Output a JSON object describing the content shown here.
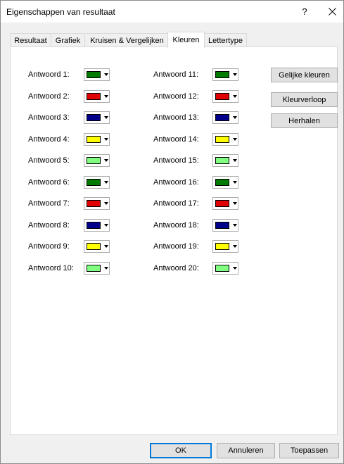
{
  "window": {
    "title": "Eigenschappen van resultaat",
    "help_label": "?",
    "close_label": "✕"
  },
  "tabs": [
    {
      "label": "Resultaat",
      "active": false
    },
    {
      "label": "Grafiek",
      "active": false
    },
    {
      "label": "Kruisen & Vergelijken",
      "active": false
    },
    {
      "label": "Kleuren",
      "active": true
    },
    {
      "label": "Lettertype",
      "active": false
    }
  ],
  "colors": {
    "green": "#007a00",
    "red": "#e00000",
    "navy": "#00008b",
    "yellow": "#ffff00",
    "light_green": "#80ff80"
  },
  "answers_left": [
    {
      "label": "Antwoord 1:",
      "color": "#007a00"
    },
    {
      "label": "Antwoord 2:",
      "color": "#e00000"
    },
    {
      "label": "Antwoord 3:",
      "color": "#00008b"
    },
    {
      "label": "Antwoord 4:",
      "color": "#ffff00"
    },
    {
      "label": "Antwoord 5:",
      "color": "#80ff80"
    },
    {
      "label": "Antwoord 6:",
      "color": "#007a00"
    },
    {
      "label": "Antwoord 7:",
      "color": "#e00000"
    },
    {
      "label": "Antwoord 8:",
      "color": "#00008b"
    },
    {
      "label": "Antwoord 9:",
      "color": "#ffff00"
    },
    {
      "label": "Antwoord 10:",
      "color": "#80ff80"
    }
  ],
  "answers_right": [
    {
      "label": "Antwoord 11:",
      "color": "#007a00"
    },
    {
      "label": "Antwoord 12:",
      "color": "#e00000"
    },
    {
      "label": "Antwoord 13:",
      "color": "#00008b"
    },
    {
      "label": "Antwoord 14:",
      "color": "#ffff00"
    },
    {
      "label": "Antwoord 15:",
      "color": "#80ff80"
    },
    {
      "label": "Antwoord 16:",
      "color": "#007a00"
    },
    {
      "label": "Antwoord 17:",
      "color": "#e00000"
    },
    {
      "label": "Antwoord 18:",
      "color": "#00008b"
    },
    {
      "label": "Antwoord 19:",
      "color": "#ffff00"
    },
    {
      "label": "Antwoord 20:",
      "color": "#80ff80"
    }
  ],
  "side_buttons": {
    "equal_colors": "Gelijke kleuren",
    "gradient": "Kleurverloop",
    "repeat": "Herhalen"
  },
  "footer": {
    "ok": "OK",
    "cancel": "Annuleren",
    "apply": "Toepassen"
  }
}
